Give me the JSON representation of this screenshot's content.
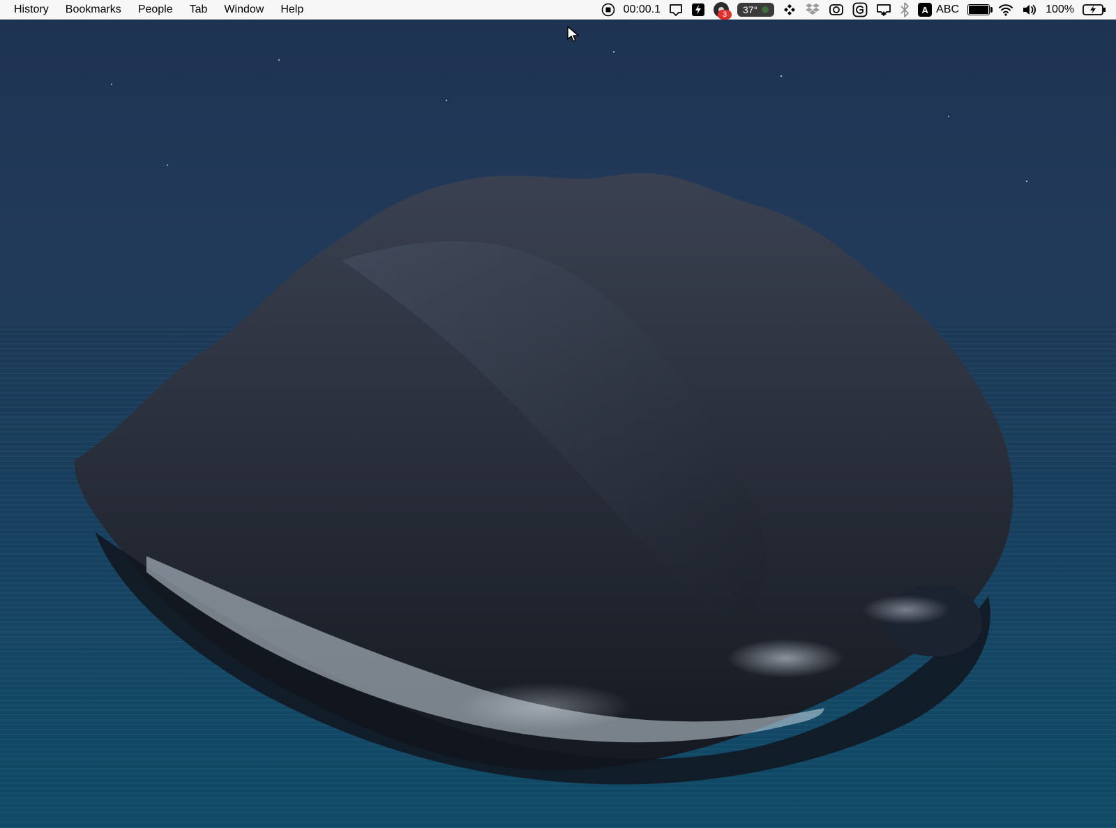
{
  "menubar": {
    "items": [
      "History",
      "Bookmarks",
      "People",
      "Tab",
      "Window",
      "Help"
    ]
  },
  "status": {
    "recording_time": "00:00.1",
    "notification_count": "3",
    "temperature": "37°",
    "input_source_letter": "A",
    "input_source_label": "ABC",
    "battery_percent": "100%"
  }
}
